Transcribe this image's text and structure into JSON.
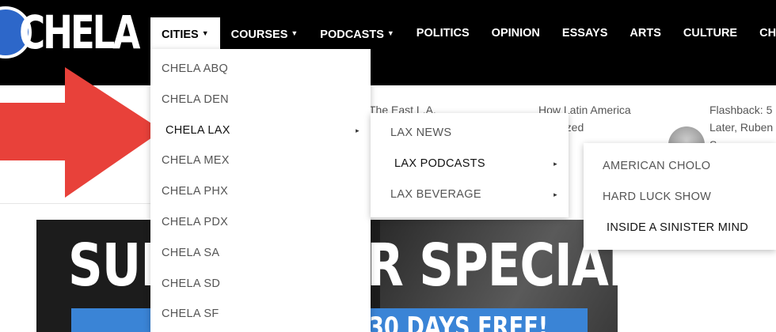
{
  "header": {
    "logo_text": "CHELA",
    "nav": [
      {
        "label": "CITIES",
        "caret": "▼",
        "active": true
      },
      {
        "label": "COURSES",
        "caret": "▼"
      },
      {
        "label": "PODCASTS",
        "caret": "▼"
      },
      {
        "label": "POLITICS"
      },
      {
        "label": "OPINION"
      },
      {
        "label": "ESSAYS"
      },
      {
        "label": "ARTS"
      },
      {
        "label": "CULTURE"
      },
      {
        "label": "CHIC"
      }
    ]
  },
  "stories": [
    {
      "line1": "The East L.A."
    },
    {
      "line1": "How Latin America",
      "line2": "onized"
    },
    {
      "line1": "Flashback: 5",
      "line2": "Later, Ruben",
      "line3": "S..."
    }
  ],
  "banner": {
    "title": "SUBSCRIBER SPECIAL",
    "subtitle": "30 DAYS FREE!"
  },
  "cities_menu": {
    "items": [
      "CHELA ABQ",
      "CHELA DEN",
      "CHELA LAX",
      "CHELA MEX",
      "CHELA PHX",
      "CHELA PDX",
      "CHELA SA",
      "CHELA SD",
      "CHELA SF"
    ],
    "submenu_caret": "▸"
  },
  "lax_menu": {
    "items": [
      "LAX NEWS",
      "LAX PODCASTS",
      "LAX BEVERAGE"
    ]
  },
  "podcasts_menu": {
    "items": [
      "AMERICAN CHOLO",
      "HARD LUCK SHOW",
      "INSIDE A SINISTER MIND"
    ]
  },
  "colors": {
    "header_bg": "#000000",
    "logo_blue": "#2d67c9",
    "arrow_red": "#e8413a",
    "banner_blue": "#3a84d6"
  }
}
